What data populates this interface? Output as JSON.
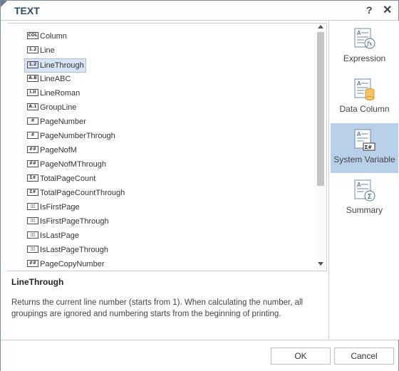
{
  "dialog": {
    "title": "TEXT",
    "help_label": "?",
    "close_label": "✕"
  },
  "list": {
    "items": [
      {
        "label": "Column",
        "icon": "COL"
      },
      {
        "label": "Line",
        "icon": "1.2"
      },
      {
        "label": "LineThrough",
        "icon": "1.2",
        "selected": true
      },
      {
        "label": "LineABC",
        "icon": "A.B"
      },
      {
        "label": "LineRoman",
        "icon": "I.II"
      },
      {
        "label": "GroupLine",
        "icon": "A.1"
      },
      {
        "label": "PageNumber",
        "icon": "#"
      },
      {
        "label": "PageNumberThrough",
        "icon": "#"
      },
      {
        "label": "PageNofM",
        "icon": "##"
      },
      {
        "label": "PageNofMThrough",
        "icon": "##"
      },
      {
        "label": "TotalPageCount",
        "icon": "Σ#"
      },
      {
        "label": "TotalPageCountThrough",
        "icon": "Σ#"
      },
      {
        "label": "IsFirstPage",
        "icon": "▯▯"
      },
      {
        "label": "IsFirstPageThrough",
        "icon": "▯▯"
      },
      {
        "label": "IsLastPage",
        "icon": "▯▯"
      },
      {
        "label": "IsLastPageThrough",
        "icon": "▯▯"
      },
      {
        "label": "PageCopyNumber",
        "icon": "##"
      }
    ]
  },
  "description": {
    "title": "LineThrough",
    "text": "Returns the current line number (starts from 1). When calculating the number, all groupings are ignored and numbering starts from the beginning of printing."
  },
  "sidebar": {
    "items": [
      {
        "label": "Expression",
        "icon": "expression-icon"
      },
      {
        "label": "Data Column",
        "icon": "data-column-icon"
      },
      {
        "label": "System Variable",
        "icon": "system-variable-icon",
        "active": true
      },
      {
        "label": "Summary",
        "icon": "summary-icon"
      }
    ]
  },
  "footer": {
    "ok_label": "OK",
    "cancel_label": "Cancel"
  },
  "colors": {
    "title": "#2a4a6b",
    "selection": "#d9e5f4",
    "sidebar_active": "#b9d0ea",
    "border": "#c9d0d6"
  }
}
